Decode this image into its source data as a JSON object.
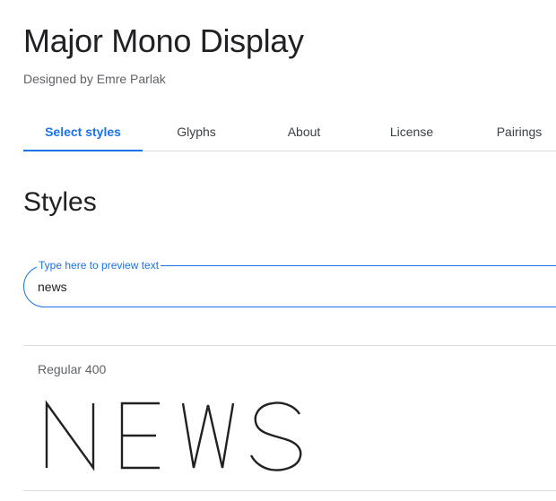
{
  "font": {
    "title": "Major Mono Display",
    "designer": "Designed by Emre Parlak"
  },
  "tabs": [
    {
      "label": "Select styles",
      "active": true
    },
    {
      "label": "Glyphs",
      "active": false
    },
    {
      "label": "About",
      "active": false
    },
    {
      "label": "License",
      "active": false
    },
    {
      "label": "Pairings",
      "active": false
    }
  ],
  "styles_section": {
    "title": "Styles"
  },
  "preview": {
    "label": "Type here to preview text",
    "value": "news"
  },
  "style_rows": [
    {
      "name": "Regular 400",
      "specimen": "NEWS"
    }
  ],
  "colors": {
    "accent": "#1a73e8",
    "text": "#202124",
    "muted": "#5f6368",
    "divider": "#dadce0"
  }
}
